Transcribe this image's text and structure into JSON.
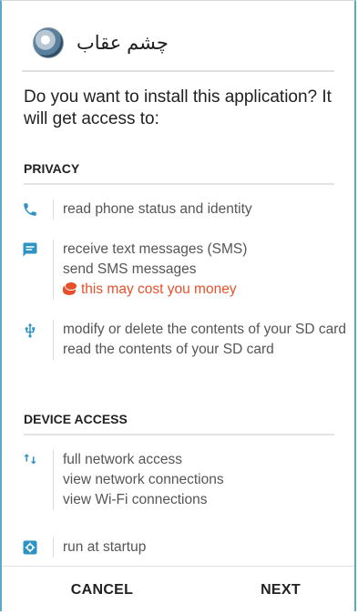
{
  "header": {
    "app_name": "چشم عقاب"
  },
  "question": "Do you want to install this application? It will get access to:",
  "sections": {
    "privacy": {
      "title": "PRIVACY",
      "groups": [
        {
          "icon": "phone-icon",
          "lines": [
            "read phone status and identity"
          ]
        },
        {
          "icon": "message-icon",
          "lines": [
            "receive text messages (SMS)",
            "send SMS messages"
          ],
          "warning": "this may cost you money"
        },
        {
          "icon": "usb-icon",
          "lines": [
            "modify or delete the contents of your SD card",
            "read the contents of your SD card"
          ]
        }
      ]
    },
    "device_access": {
      "title": "DEVICE ACCESS",
      "groups": [
        {
          "icon": "network-arrows-icon",
          "lines": [
            "full network access",
            "view network connections",
            "view Wi-Fi connections"
          ]
        },
        {
          "icon": "startup-gear-icon",
          "lines": [
            "run at startup"
          ]
        }
      ]
    }
  },
  "footer": {
    "cancel_label": "CANCEL",
    "next_label": "NEXT"
  },
  "colors": {
    "accent_icon": "#2c93c3",
    "warning": "#e8502b",
    "frame_border": "#5aa9c8"
  }
}
